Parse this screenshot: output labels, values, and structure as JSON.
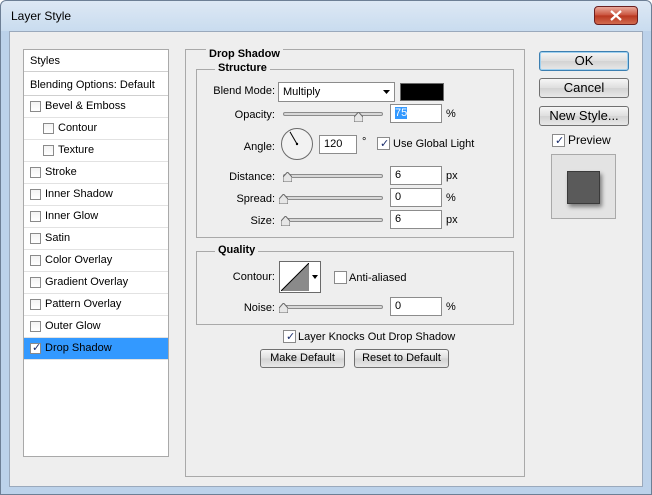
{
  "window": {
    "title": "Layer Style"
  },
  "styles_list": {
    "header": "Styles",
    "blending_options": "Blending Options: Default",
    "items": [
      {
        "label": "Bevel & Emboss",
        "checked": false,
        "indent": false
      },
      {
        "label": "Contour",
        "checked": false,
        "indent": true
      },
      {
        "label": "Texture",
        "checked": false,
        "indent": true
      },
      {
        "label": "Stroke",
        "checked": false,
        "indent": false
      },
      {
        "label": "Inner Shadow",
        "checked": false,
        "indent": false
      },
      {
        "label": "Inner Glow",
        "checked": false,
        "indent": false
      },
      {
        "label": "Satin",
        "checked": false,
        "indent": false
      },
      {
        "label": "Color Overlay",
        "checked": false,
        "indent": false
      },
      {
        "label": "Gradient Overlay",
        "checked": false,
        "indent": false
      },
      {
        "label": "Pattern Overlay",
        "checked": false,
        "indent": false
      },
      {
        "label": "Outer Glow",
        "checked": false,
        "indent": false
      },
      {
        "label": "Drop Shadow",
        "checked": true,
        "indent": false,
        "selected": true
      }
    ]
  },
  "panel": {
    "title": "Drop Shadow",
    "structure": {
      "legend": "Structure",
      "blend_mode_label": "Blend Mode:",
      "blend_mode_value": "Multiply",
      "shadow_color": "#000000",
      "opacity_label": "Opacity:",
      "opacity_value": "75",
      "opacity_level": 0.75,
      "opacity_unit": "%",
      "angle_label": "Angle:",
      "angle_value": "120",
      "angle_unit": "°",
      "use_global_light_label": "Use Global Light",
      "use_global_light": true,
      "distance_label": "Distance:",
      "distance_value": "6",
      "distance_unit": "px",
      "spread_label": "Spread:",
      "spread_value": "0",
      "spread_unit": "%",
      "size_label": "Size:",
      "size_value": "6",
      "size_unit": "px"
    },
    "quality": {
      "legend": "Quality",
      "contour_label": "Contour:",
      "anti_aliased_label": "Anti-aliased",
      "anti_aliased": false,
      "noise_label": "Noise:",
      "noise_value": "0",
      "noise_unit": "%"
    },
    "knocks_out_label": "Layer Knocks Out Drop Shadow",
    "knocks_out": true,
    "make_default_label": "Make Default",
    "reset_default_label": "Reset to Default"
  },
  "buttons": {
    "ok": "OK",
    "cancel": "Cancel",
    "new_style": "New Style...",
    "preview_label": "Preview",
    "preview": true
  },
  "colors": {
    "selection": "#3399ff",
    "preview_swatch": "#5a5a5a"
  }
}
